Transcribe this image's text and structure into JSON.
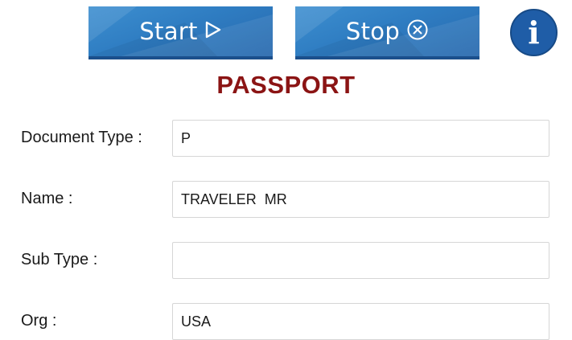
{
  "toolbar": {
    "start_label": "Start",
    "stop_label": "Stop",
    "info_label": "i",
    "start_icon": "play-outline-icon",
    "stop_icon": "circle-x-icon",
    "accent": "#2f7dc2",
    "info_color": "#1f5da7"
  },
  "page": {
    "title": "PASSPORT",
    "title_color": "#8b1414"
  },
  "form": {
    "fields": [
      {
        "label": "Document Type :",
        "value": "P"
      },
      {
        "label": "Name :",
        "value": "TRAVELER  MR"
      },
      {
        "label": "Sub Type :",
        "value": ""
      },
      {
        "label": "Org :",
        "value": "USA"
      }
    ]
  }
}
